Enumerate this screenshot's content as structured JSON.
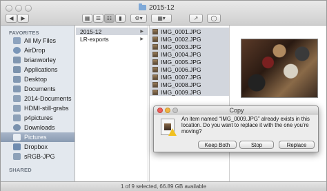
{
  "window": {
    "title": "2015-12"
  },
  "toolbar": {
    "back_icon": "chevron-left-icon",
    "forward_icon": "chevron-right-icon",
    "view_icons": [
      "icon-view-icon",
      "list-view-icon",
      "column-view-icon",
      "cover-flow-icon"
    ],
    "action_icon": "gear-icon",
    "arrange_icon": "arrange-icon",
    "share_icon": "share-icon",
    "tag_icon": "tag-icon"
  },
  "sidebar": {
    "favorites_heading": "FAVORITES",
    "shared_heading": "SHARED",
    "items": [
      {
        "label": "All My Files",
        "icon": "all-files-icon"
      },
      {
        "label": "AirDrop",
        "icon": "airdrop-icon"
      },
      {
        "label": "brianworley",
        "icon": "home-icon"
      },
      {
        "label": "Applications",
        "icon": "applications-icon"
      },
      {
        "label": "Desktop",
        "icon": "desktop-icon"
      },
      {
        "label": "Documents",
        "icon": "documents-icon"
      },
      {
        "label": "2014-Documents",
        "icon": "folder-icon"
      },
      {
        "label": "HDMI-still-grabs",
        "icon": "folder-icon"
      },
      {
        "label": "p4pictures",
        "icon": "folder-icon"
      },
      {
        "label": "Downloads",
        "icon": "downloads-icon"
      },
      {
        "label": "Pictures",
        "icon": "pictures-icon",
        "selected": true
      },
      {
        "label": "Dropbox",
        "icon": "dropbox-icon"
      },
      {
        "label": "sRGB-JPG",
        "icon": "folder-icon"
      }
    ]
  },
  "columns": {
    "folders": [
      {
        "label": "2015-12",
        "selected": true
      },
      {
        "label": "LR-exports",
        "selected": false
      }
    ],
    "files": [
      "IMG_0001.JPG",
      "IMG_0002.JPG",
      "IMG_0003.JPG",
      "IMG_0004.JPG",
      "IMG_0005.JPG",
      "IMG_0006.JPG",
      "IMG_0007.JPG",
      "IMG_0008.JPG",
      "IMG_0009.JPG"
    ]
  },
  "status": {
    "text": "1 of 9 selected, 66.89 GB available"
  },
  "dialog": {
    "title": "Copy",
    "message": "An item named “IMG_0009.JPG” already exists in this location. Do you want to replace it with the one you’re moving?",
    "buttons": {
      "keep_both": "Keep Both",
      "stop": "Stop",
      "replace": "Replace"
    },
    "colors": {
      "close": "#ec5f5a",
      "minimize": "#f0b441",
      "zoom": "#c7c7c7"
    }
  }
}
